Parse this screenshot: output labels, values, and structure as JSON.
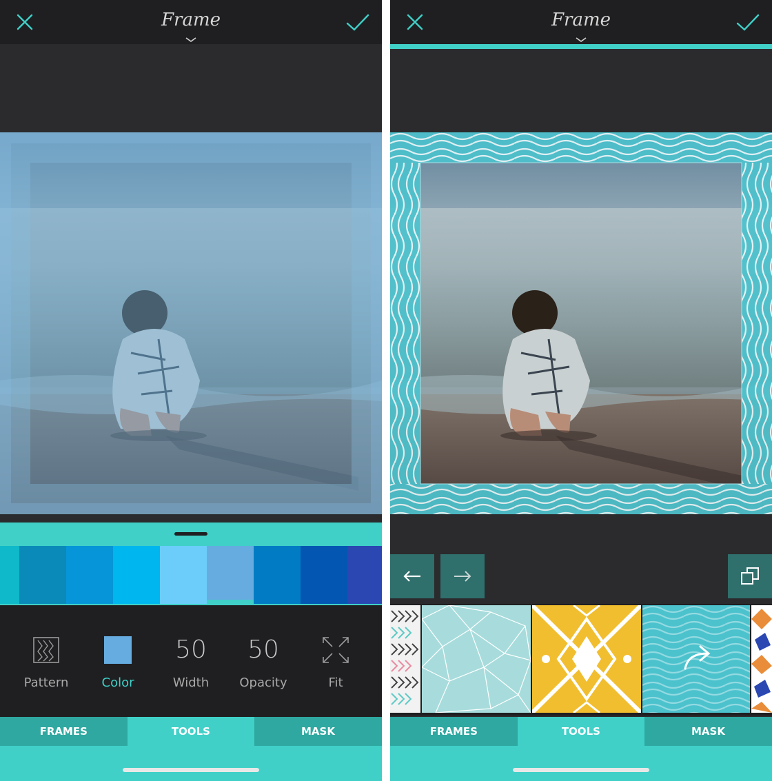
{
  "left": {
    "title": "Frame",
    "icons": {
      "close": "close-icon",
      "confirm": "check-icon",
      "expand": "chevron-down-icon"
    },
    "swatch_colors": [
      "#0fb9c9",
      "#0a8ab8",
      "#0595d8",
      "#00b6ef",
      "#6ccdfa",
      "#66ace0",
      "#017bc4",
      "#0357b3",
      "#2b47b2"
    ],
    "selected_swatch": 5,
    "tools": [
      {
        "label": "Pattern",
        "icon": "pattern-icon"
      },
      {
        "label": "Color",
        "icon": "color-swatch-icon",
        "active": true
      },
      {
        "label": "Width",
        "value": "50"
      },
      {
        "label": "Opacity",
        "value": "50"
      },
      {
        "label": "Fit",
        "icon": "expand-arrows-icon"
      }
    ],
    "tabs": [
      "FRAMES",
      "TOOLS",
      "MASK"
    ],
    "active_tab": "TOOLS"
  },
  "right": {
    "title": "Frame",
    "icons": {
      "close": "close-icon",
      "confirm": "check-icon",
      "expand": "chevron-down-icon",
      "back": "arrow-left-icon",
      "forward": "arrow-right-icon",
      "copy": "copy-icon",
      "share": "share-arrow-icon"
    },
    "pattern_tiles": [
      "arrows-pattern",
      "triangles-pattern",
      "yellow-geometric-pattern",
      "wave-pattern",
      "blue-orange-pattern"
    ],
    "tabs": [
      "FRAMES",
      "TOOLS",
      "MASK"
    ],
    "active_tab": "TOOLS"
  },
  "colors": {
    "accent": "#40d0c8",
    "tab": "#2ea8a0",
    "topbar": "#1f1f21",
    "background": "#2b2b2d"
  }
}
